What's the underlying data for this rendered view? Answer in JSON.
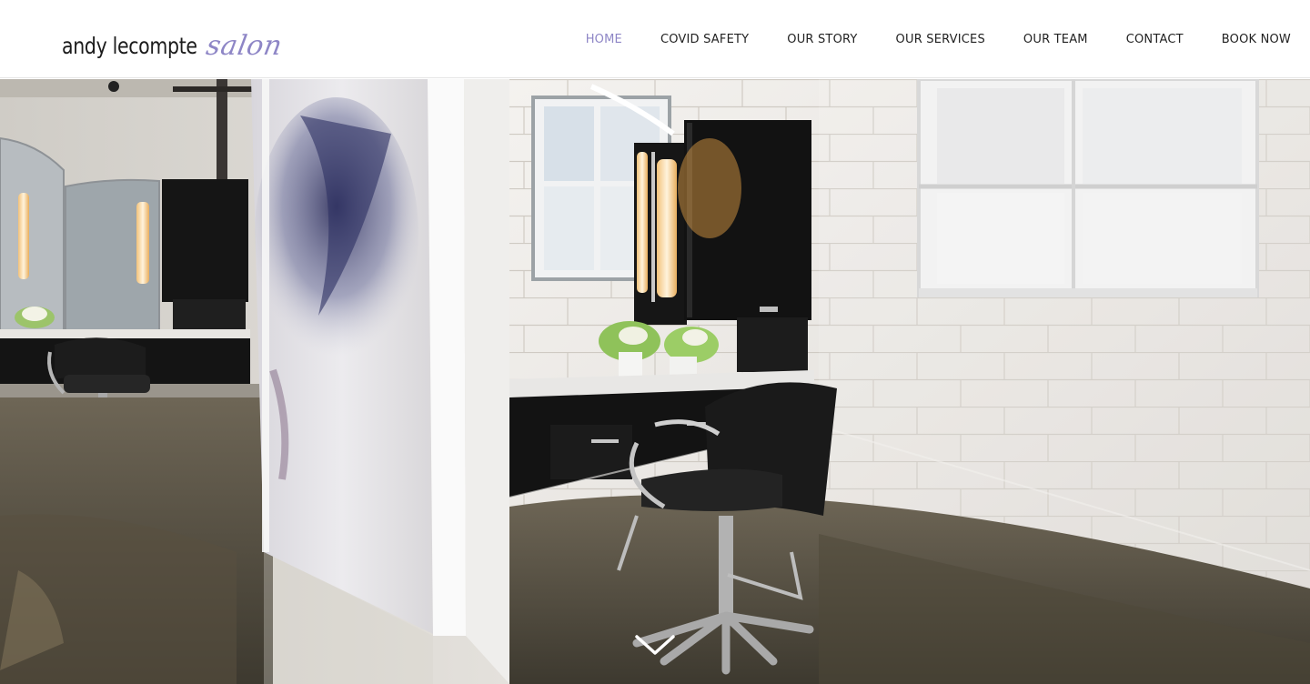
{
  "brand": {
    "name": "andy lecompte",
    "script": "salon",
    "accent_color": "#8e86c6"
  },
  "nav": {
    "items": [
      {
        "label": "HOME",
        "active": true
      },
      {
        "label": "COVID SAFETY",
        "active": false
      },
      {
        "label": "OUR STORY",
        "active": false
      },
      {
        "label": "OUR SERVICES",
        "active": false
      },
      {
        "label": "OUR TEAM",
        "active": false
      },
      {
        "label": "CONTACT",
        "active": false
      },
      {
        "label": "BOOK NOW",
        "active": false
      }
    ]
  },
  "hero": {
    "scroll_icon": "chevron-down-icon"
  }
}
